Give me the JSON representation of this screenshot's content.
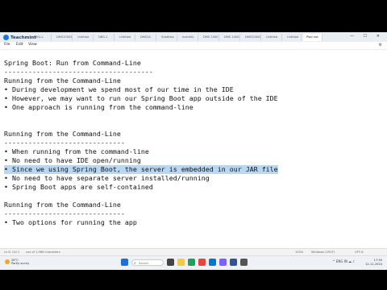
{
  "app": {
    "name": "Teachmint"
  },
  "tabs": [
    {
      "label": "BSL-L"
    },
    {
      "label": "DMS1000Z"
    },
    {
      "label": "Untitled"
    },
    {
      "label": "DBG-1"
    },
    {
      "label": "Untitled"
    },
    {
      "label": "DMS1A"
    },
    {
      "label": "Subtitles"
    },
    {
      "label": "eventAL"
    },
    {
      "label": "DMS 1000"
    },
    {
      "label": "DMS 1000Z"
    },
    {
      "label": "DMS1000Z"
    },
    {
      "label": "Untitled"
    },
    {
      "label": "Untitled"
    },
    {
      "label": "Plain.txt"
    }
  ],
  "window_controls": "— ☐ ✕",
  "menu": {
    "file": "File",
    "edit": "Edit",
    "view": "View"
  },
  "editor_lines": [
    {
      "text": ""
    },
    {
      "text": "Spring Boot: Run from Command-Line"
    },
    {
      "text": "-------------------------------------"
    },
    {
      "text": "Running from the Command-Line"
    },
    {
      "text": "• During development we spend most of our time in the IDE"
    },
    {
      "text": "• However, we may want to run our Spring Boot app outside of the IDE"
    },
    {
      "text": "• One approach is running from the command-line"
    },
    {
      "text": ""
    },
    {
      "text": ""
    },
    {
      "text": "Running from the Command-Line"
    },
    {
      "text": "------------------------------"
    },
    {
      "text": "• When running from the command-line"
    },
    {
      "text": "• No need to have IDE open/running"
    },
    {
      "text": "• Since we using Spring Boot, the server is embedded in our JAR file"
    },
    {
      "text": "• No need to have separate server installed/running"
    },
    {
      "text": "• Spring Boot apps are self-contained"
    },
    {
      "text": ""
    },
    {
      "text": "Running from the Command-Line"
    },
    {
      "text": "------------------------------"
    },
    {
      "text": "• Two options for running the app"
    }
  ],
  "status": {
    "position": "Ln 8, Col 1",
    "characters": "xxx of 1,966 characters",
    "zoom": "100%",
    "line_ending": "Windows (CRLF)",
    "encoding": "UTF-8"
  },
  "taskbar": {
    "weather_temp": "28°C",
    "weather_desc": "Partly sunny",
    "search_placeholder": "Search",
    "language": "ENG IN",
    "time": "17:35",
    "date": "12-11-2024"
  },
  "colors": {
    "highlight": "#b7d8f5",
    "accent": "#1a73e8"
  }
}
